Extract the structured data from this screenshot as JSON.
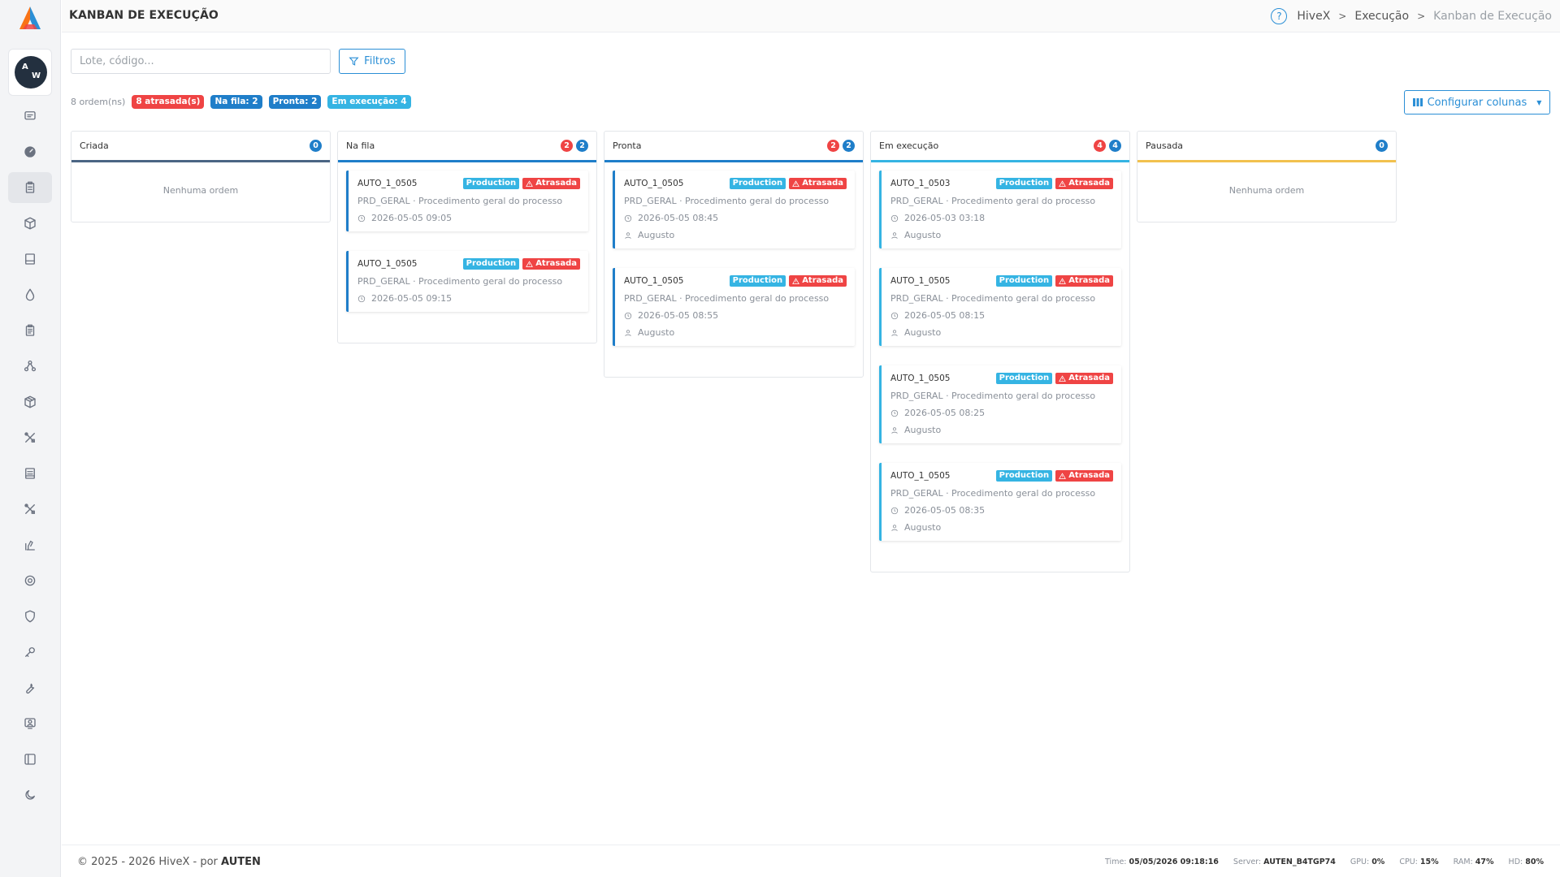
{
  "header": {
    "title": "KANBAN DE EXECUÇÃO",
    "breadcrumb": [
      "HiveX",
      "Execução",
      "Kanban de Execução"
    ]
  },
  "user": {
    "initials_top": "A",
    "initials_bottom": "W"
  },
  "sidebar": {
    "icons": [
      "message-icon",
      "gauge-icon",
      "clipboard-icon",
      "box-icon",
      "book-icon",
      "droplet-icon",
      "clipboard-list-icon",
      "nodes-icon",
      "package-icon",
      "tools-icon",
      "document-icon",
      "tools-icon",
      "lab-icon",
      "settings-icon",
      "shield-icon",
      "key-icon",
      "wrench-icon",
      "monitor-user-icon",
      "sidebar-panel-icon",
      "moon-icon"
    ],
    "active_index": 2
  },
  "toolbar": {
    "search_placeholder": "Lote, código...",
    "filter_label": "Filtros",
    "configure_columns_label": "Configurar colunas"
  },
  "summary": {
    "orders": "8 ordem(ns)",
    "late": "8 atrasada(s)",
    "queue": "Na fila: 2",
    "ready": "Pronta: 2",
    "running": "Em execução: 4"
  },
  "columns": [
    {
      "title": "Criada",
      "color": "#4b6584",
      "late": null,
      "total": "0",
      "empty_text": "Nenhuma ordem",
      "cards": []
    },
    {
      "title": "Na fila",
      "color": "#1f7ec9",
      "late": "2",
      "total": "2",
      "empty_text": "",
      "cards": [
        {
          "code": "AUTO_1_0505",
          "type": "Production",
          "status": "Atrasada",
          "desc": "PRD_GERAL · Procedimento geral do processo",
          "time": "2026-05-05 09:05",
          "user": ""
        },
        {
          "code": "AUTO_1_0505",
          "type": "Production",
          "status": "Atrasada",
          "desc": "PRD_GERAL · Procedimento geral do processo",
          "time": "2026-05-05 09:15",
          "user": ""
        }
      ]
    },
    {
      "title": "Pronta",
      "color": "#1f7ec9",
      "late": "2",
      "total": "2",
      "empty_text": "",
      "cards": [
        {
          "code": "AUTO_1_0505",
          "type": "Production",
          "status": "Atrasada",
          "desc": "PRD_GERAL · Procedimento geral do processo",
          "time": "2026-05-05 08:45",
          "user": "Augusto"
        },
        {
          "code": "AUTO_1_0505",
          "type": "Production",
          "status": "Atrasada",
          "desc": "PRD_GERAL · Procedimento geral do processo",
          "time": "2026-05-05 08:55",
          "user": "Augusto"
        }
      ]
    },
    {
      "title": "Em execução",
      "color": "#35b4e3",
      "late": "4",
      "total": "4",
      "empty_text": "",
      "cards": [
        {
          "code": "AUTO_1_0503",
          "type": "Production",
          "status": "Atrasada",
          "desc": "PRD_GERAL · Procedimento geral do processo",
          "time": "2026-05-03 03:18",
          "user": "Augusto"
        },
        {
          "code": "AUTO_1_0505",
          "type": "Production",
          "status": "Atrasada",
          "desc": "PRD_GERAL · Procedimento geral do processo",
          "time": "2026-05-05 08:15",
          "user": "Augusto"
        },
        {
          "code": "AUTO_1_0505",
          "type": "Production",
          "status": "Atrasada",
          "desc": "PRD_GERAL · Procedimento geral do processo",
          "time": "2026-05-05 08:25",
          "user": "Augusto"
        },
        {
          "code": "AUTO_1_0505",
          "type": "Production",
          "status": "Atrasada",
          "desc": "PRD_GERAL · Procedimento geral do processo",
          "time": "2026-05-05 08:35",
          "user": "Augusto"
        }
      ]
    },
    {
      "title": "Pausada",
      "color": "#f2c14e",
      "late": null,
      "total": "0",
      "empty_text": "Nenhuma ordem",
      "cards": []
    }
  ],
  "footer": {
    "copyright": "© 2025 - 2026 HiveX - por",
    "company": "AUTEN",
    "time_label": "Time:",
    "time_value": "05/05/2026 09:18:16",
    "server_label": "Server:",
    "server_value": "AUTEN_B4TGP74",
    "gpu_label": "GPU:",
    "gpu_value": "0%",
    "cpu_label": "CPU:",
    "cpu_value": "15%",
    "ram_label": "RAM:",
    "ram_value": "47%",
    "hd_label": "HD:",
    "hd_value": "80%"
  }
}
